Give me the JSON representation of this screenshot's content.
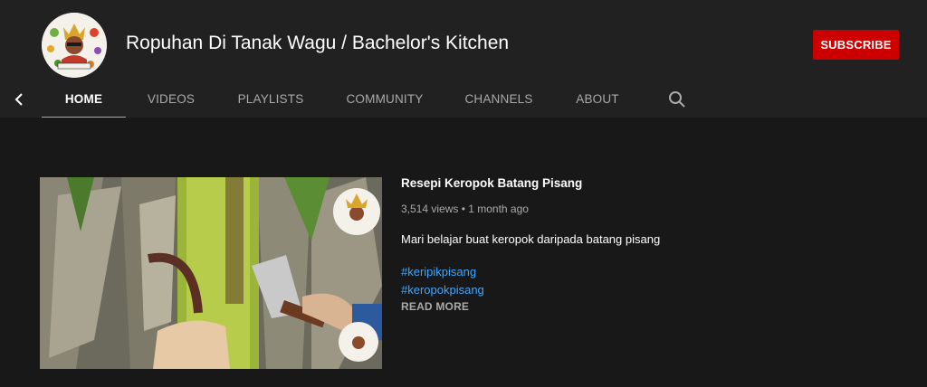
{
  "channel": {
    "avatar_icon": "chef-mascot-logo",
    "name": "Ropuhan Di Tanak Wagu / Bachelor's Kitchen",
    "subscribe_label": "SUBSCRIBE"
  },
  "tabs": {
    "back_icon": "chevron-left-icon",
    "items": [
      {
        "label": "HOME",
        "active": true
      },
      {
        "label": "VIDEOS"
      },
      {
        "label": "PLAYLISTS"
      },
      {
        "label": "COMMUNITY"
      },
      {
        "label": "CHANNELS"
      },
      {
        "label": "ABOUT"
      }
    ],
    "search_icon": "search-icon"
  },
  "featured": {
    "title": "Resepi Keropok Batang Pisang",
    "meta": "3,514 views • 1 month ago",
    "description": "Mari belajar buat keropok daripada batang pisang",
    "hashtags": [
      "#keripikpisang",
      "#keropokpisang"
    ],
    "read_more": "READ MORE"
  },
  "colors": {
    "header_bg": "#212121",
    "page_bg": "#181818",
    "subscribe": "#cc0000",
    "link": "#3ea6ff",
    "muted": "#aaaaaa"
  }
}
